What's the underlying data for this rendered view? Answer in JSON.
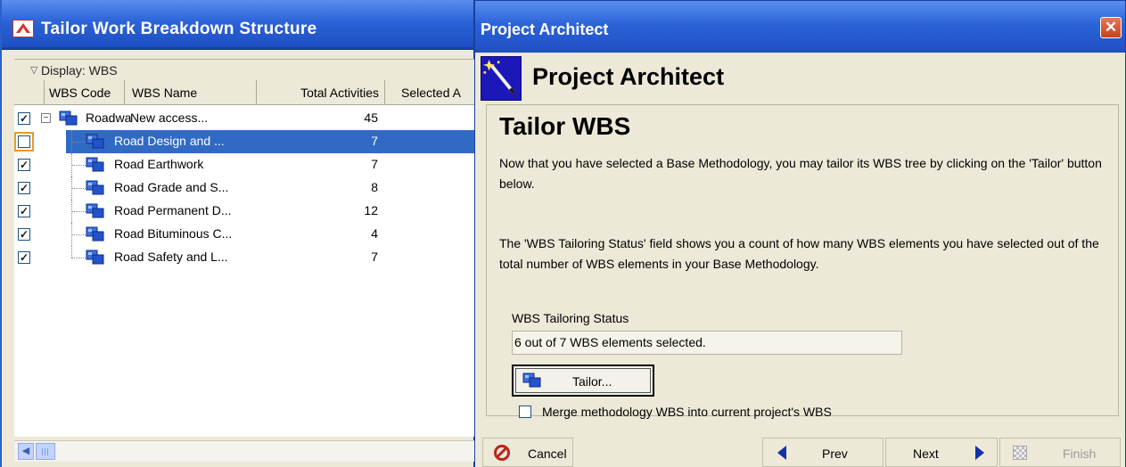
{
  "left_window": {
    "title": "Tailor Work Breakdown Structure",
    "display_label": "Display: WBS",
    "columns": {
      "code": "WBS Code",
      "name": "WBS Name",
      "total": "Total Activities",
      "selected": "Selected A"
    },
    "rows": [
      {
        "code": "Roadwa",
        "name": "New access...",
        "total": "45",
        "checked": true,
        "root": true,
        "selected": false
      },
      {
        "code": "",
        "name": "Road Design and ...",
        "total": "7",
        "checked": false,
        "root": false,
        "selected": true
      },
      {
        "code": "",
        "name": "Road Earthwork",
        "total": "7",
        "checked": true,
        "root": false,
        "selected": false
      },
      {
        "code": "",
        "name": "Road Grade and S...",
        "total": "8",
        "checked": true,
        "root": false,
        "selected": false
      },
      {
        "code": "",
        "name": "Road Permanent D...",
        "total": "12",
        "checked": true,
        "root": false,
        "selected": false
      },
      {
        "code": "",
        "name": "Road Bituminous C...",
        "total": "4",
        "checked": true,
        "root": false,
        "selected": false
      },
      {
        "code": "",
        "name": "Road Safety and L...",
        "total": "7",
        "checked": true,
        "root": false,
        "selected": false
      }
    ],
    "selection_color": "#316ac5"
  },
  "right_window": {
    "title": "Project Architect",
    "header_title": "Project Architect",
    "panel_title": "Tailor WBS",
    "para1": "Now that you have selected a Base Methodology, you may tailor its WBS tree by clicking on the 'Tailor' button below.",
    "para2": "The 'WBS Tailoring Status' field shows you a count of how many WBS elements you have selected out of the total number of WBS elements in your Base Methodology.",
    "status_label": "WBS Tailoring Status",
    "status_value": "6 out of 7 WBS elements selected.",
    "tailor_button": "Tailor...",
    "merge_label": "Merge methodology WBS into current project's WBS",
    "merge_checked": false,
    "buttons": {
      "cancel": "Cancel",
      "prev": "Prev",
      "next": "Next",
      "finish": "Finish"
    },
    "icons": [
      "close-icon",
      "wizard-wand-icon",
      "wbs-node-icon",
      "cancel-icon",
      "prev-arrow-icon",
      "next-arrow-icon",
      "finish-icon"
    ]
  }
}
